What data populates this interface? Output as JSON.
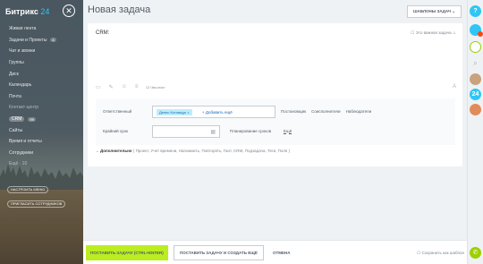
{
  "sidebar": {
    "logo_name": "Битрикс",
    "logo_num": "24",
    "items": [
      {
        "label": "Живая лента"
      },
      {
        "label": "Задачи и Проекты",
        "count": "4"
      },
      {
        "label": "Чат и звонки"
      },
      {
        "label": "Группы"
      },
      {
        "label": "Диск"
      },
      {
        "label": "Календарь"
      },
      {
        "label": "Почта"
      },
      {
        "label": "Контакт-центр"
      },
      {
        "label": "CRM",
        "count": "99"
      },
      {
        "label": "Сайты"
      },
      {
        "label": "Время и отчеты"
      },
      {
        "label": "Сотрудники"
      },
      {
        "label": "Ещё · 10"
      }
    ],
    "settings_btn": "НАСТРОИТЬ МЕНЮ",
    "invite_btn": "ПРИГЛАСИТЬ СОТРУДНИКОВ"
  },
  "header": {
    "title": "Новая задача",
    "templates_btn": "ШАБЛОНЫ ЗАДАЧ"
  },
  "form": {
    "title_value": "CRM:",
    "important_label": "Это важная задача",
    "checklist_label": "Чек-лист",
    "responsible_label": "Ответственный",
    "responsible_tag": "Денис Котовщук",
    "add_more": "+ Добавить ещё",
    "role_links": [
      "Постановщик",
      "Соисполнители",
      "Наблюдатели"
    ],
    "deadline_label": "Крайний срок",
    "deadline_value": "",
    "planning_link": "Планирование сроков",
    "more_link": "Ещё",
    "additional_label": "Дополнительно",
    "additional_items": "( Проект,  Учет времени,  Напомнить,  Повторять,  Гант,  CRM,  Подзадача,  Теги,  Поля )"
  },
  "footer": {
    "submit_btn": "ПОСТАВИТЬ ЗАДАЧУ (CTRL+ENTER)",
    "submit_create_btn": "ПОСТАВИТЬ ЗАДАЧУ И СОЗДАТЬ ЕЩЁ",
    "cancel_btn": "ОТМЕНА",
    "save_template": "Сохранить как шаблон"
  },
  "rightbar": {
    "badge1": "?",
    "badge_num": "24"
  },
  "colors": {
    "accent_green": "#bbed21",
    "link_blue": "#2067b0",
    "tag_bg": "#bcedfc",
    "brand_blue": "#2fc6f6"
  }
}
